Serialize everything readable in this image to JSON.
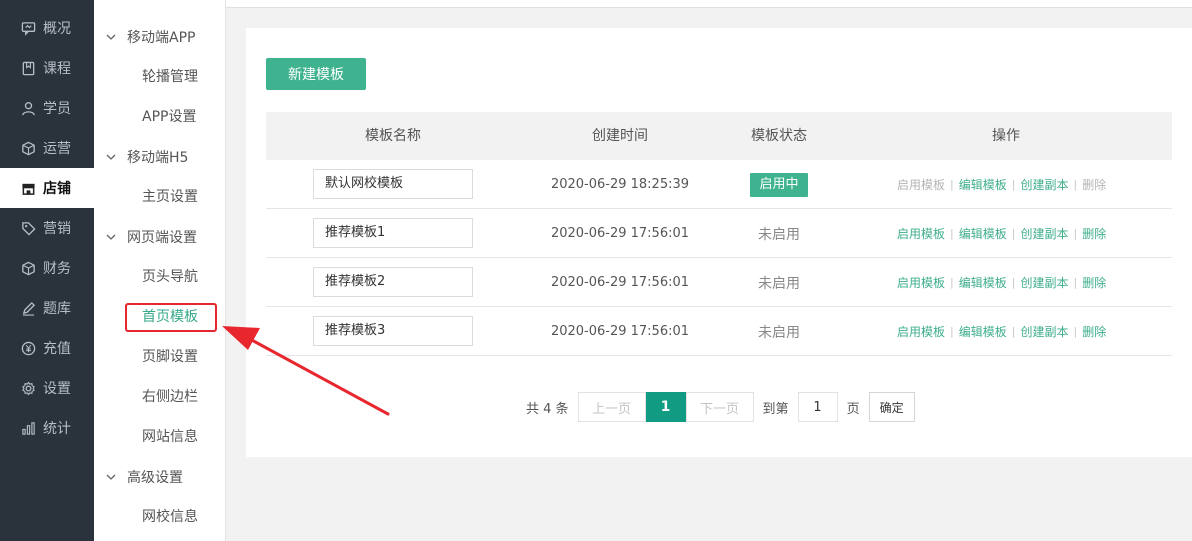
{
  "nav": [
    {
      "label": "概况",
      "icon": "chat-icon"
    },
    {
      "label": "课程",
      "icon": "book-icon"
    },
    {
      "label": "学员",
      "icon": "user-icon"
    },
    {
      "label": "运营",
      "icon": "cube-icon"
    },
    {
      "label": "店铺",
      "icon": "store-icon",
      "active": true
    },
    {
      "label": "营销",
      "icon": "tag-icon"
    },
    {
      "label": "财务",
      "icon": "cube-icon"
    },
    {
      "label": "题库",
      "icon": "pen-icon"
    },
    {
      "label": "充值",
      "icon": "yen-icon"
    },
    {
      "label": "设置",
      "icon": "gear-icon"
    },
    {
      "label": "统计",
      "icon": "bar-chart-icon"
    }
  ],
  "submenu": {
    "app_group": "移动端APP",
    "app_items": [
      "轮播管理",
      "APP设置"
    ],
    "h5_group": "移动端H5",
    "h5_items": [
      "主页设置"
    ],
    "web_group": "网页端设置",
    "web_items": [
      "页头导航",
      "首页模板",
      "页脚设置",
      "右侧边栏",
      "网站信息"
    ],
    "adv_group": "高级设置",
    "adv_items": [
      "网校信息"
    ],
    "active": "首页模板"
  },
  "toolbar": {
    "new_label": "新建模板"
  },
  "table": {
    "headers": [
      "模板名称",
      "创建时间",
      "模板状态",
      "操作"
    ],
    "rows": [
      {
        "name": "默认网校模板",
        "time": "2020-06-29 18:25:39",
        "status": "启用中",
        "active": true
      },
      {
        "name": "推荐模板1",
        "time": "2020-06-29 17:56:01",
        "status": "未启用",
        "active": false
      },
      {
        "name": "推荐模板2",
        "time": "2020-06-29 17:56:01",
        "status": "未启用",
        "active": false
      },
      {
        "name": "推荐模板3",
        "time": "2020-06-29 17:56:01",
        "status": "未启用",
        "active": false
      }
    ],
    "actions": {
      "enable": "启用模板",
      "edit": "编辑模板",
      "copy": "创建副本",
      "delete": "删除"
    }
  },
  "pagination": {
    "total_text": "共 4 条",
    "prev": "上一页",
    "current": "1",
    "next": "下一页",
    "goto_label": "到第",
    "page_input": "1",
    "page_unit": "页",
    "confirm": "确定"
  },
  "colors": {
    "accent": "#3fb28f",
    "highlight": "#e8262d",
    "nav_bg": "#2a323c"
  }
}
